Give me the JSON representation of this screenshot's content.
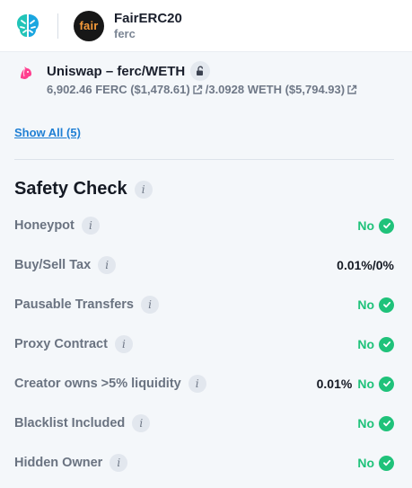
{
  "header": {
    "brand_logo_icon": "brain-leaf-logo-icon",
    "token_avatar_text": "fair",
    "token_name": "FairERC20",
    "token_symbol": "ferc"
  },
  "pair": {
    "icon": "uniswap-unicorn-icon",
    "title": "Uniswap – ferc/WETH",
    "lock_icon": "unlock-icon",
    "amount_a": "6,902.46 FERC ($1,478.61)",
    "separator": " / ",
    "amount_b": "3.0928 WETH ($5,794.93)",
    "external_link_icon": "external-link-icon"
  },
  "show_all": "Show All (5)",
  "safety": {
    "title": "Safety Check",
    "rows": [
      {
        "label": "Honeypot",
        "value": "No"
      },
      {
        "label": "Buy/Sell Tax",
        "value": "0.01%/0%"
      },
      {
        "label": "Pausable Transfers",
        "value": "No"
      },
      {
        "label": "Proxy Contract",
        "value": "No"
      },
      {
        "label": "Creator owns >5% liquidity",
        "pct": "0.01%",
        "value": "No"
      },
      {
        "label": "Blacklist Included",
        "value": "No"
      },
      {
        "label": "Hidden Owner",
        "value": "No"
      }
    ]
  },
  "colors": {
    "accent_link": "#1f7fd4",
    "success": "#1fc27a",
    "brand_teal": "#19c4c8"
  }
}
